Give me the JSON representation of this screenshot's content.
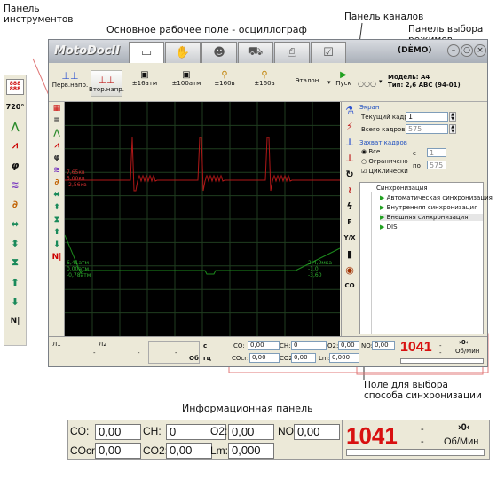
{
  "annotations": {
    "tools_panel": "Панель\nинструментов",
    "workspace": "Основное рабочее поле - осциллограф",
    "channels_panel": "Панель каналов",
    "mode_panel": "Панель выбора\nрежимов",
    "sync_field": "Поле для выбора\nспособа синхронизации",
    "info_panel": "Информационная панель"
  },
  "window": {
    "logo": "MotoDocII",
    "demo_dot": ".",
    "demo": "(DEMO)",
    "model_label": "Модель: А4",
    "type_label": "Тип: 2,6 ABC (94-01)",
    "tabs": [
      "monitor",
      "hand",
      "people",
      "car",
      "printer",
      "checklist"
    ]
  },
  "toolbar": {
    "items": [
      "Перв.напр.",
      "Втор.напр.",
      "±16атм",
      "±100атм",
      "±160в",
      "±160в",
      "Эталон",
      "Пуск"
    ]
  },
  "tools": [
    "grid",
    "720",
    "peaks",
    "zigzag",
    "phi",
    "waves",
    "lines",
    "h-arrows",
    "v-arrows",
    "h-arrows-2",
    "v-arrows-2",
    "up",
    "down",
    "nd"
  ],
  "left_tools_main": {
    "grid_text": "888\n888",
    "nd_text": "N|"
  },
  "scope": {
    "red_labels": [
      "7,65кв",
      "5,00кв",
      "-2,56кв"
    ],
    "green_labels_left": [
      "6,41атм",
      "0,00атм",
      "-0,78атм"
    ],
    "green_labels_right": [
      "2,4,0мка",
      "-1,0",
      "-3,60"
    ]
  },
  "right_panel": {
    "screen_group": "Экран",
    "current_frame_label": "Текущий кадр",
    "current_frame": "1",
    "total_frames_label": "Всего кадров",
    "total_frames": "575",
    "capture_group": "Захват кадров",
    "capture_options": [
      "Все",
      "Ограничено",
      "Циклически"
    ],
    "from_label": "с",
    "from_value": "1",
    "to_label": "по",
    "to_value": "575",
    "sync_title": "Синхронизация",
    "sync_items": [
      "Автоматическая синхронизация",
      "Внутренняя синхронизация",
      "Внешняя синхронизация",
      "DIS"
    ],
    "right_tool_labels": [
      "F",
      "Y/X",
      "CO"
    ]
  },
  "status": {
    "l1": "Л1",
    "l2": "Л2",
    "dash": "-",
    "c_label": "с",
    "gz_label": "гц",
    "ob_label": "Об"
  },
  "info": {
    "co_label": "CO:",
    "co_value": "0,00",
    "ch_label": "CH:",
    "ch_value": "0",
    "o2_label": "O2:",
    "o2_value": "0,00",
    "no_label": "NO:",
    "no_value": "0,00",
    "cocr_label": "COcr:",
    "cocr_value": "0,00",
    "co2_label": "CO2:",
    "co2_value": "0,00",
    "lm_label": "Lm:",
    "lm_value": "0,000",
    "rpm": "1041",
    "rpm_sub1": "›0‹",
    "rpm_unit": "Об/Мин",
    "dash": "-"
  },
  "colors": {
    "accent_red": "#d81010",
    "trace_red": "#b01818",
    "trace_green": "#1c8a1c",
    "grid": "#1f3d1f"
  }
}
